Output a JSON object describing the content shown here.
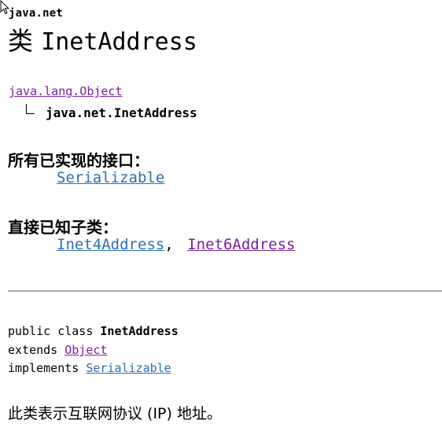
{
  "header": {
    "package_name": "java.net",
    "title_kind": "类",
    "class_name": "InetAddress"
  },
  "hierarchy": {
    "superclass": "java.lang.Object",
    "this_class": "java.net.InetAddress"
  },
  "interfaces": {
    "heading": "所有已实现的接口：",
    "items": [
      "Serializable"
    ]
  },
  "subclasses": {
    "heading": "直接已知子类：",
    "items": [
      "Inet4Address",
      "Inet6Address"
    ],
    "separator": ","
  },
  "declaration": {
    "modifiers": "public class",
    "name": "InetAddress",
    "extends_kw": "extends",
    "extends_link": "Object",
    "implements_kw": "implements",
    "implements_link": "Serializable"
  },
  "description": "此类表示互联网协议 (IP) 地址。",
  "colors": {
    "link_visited": "#7a1fa2",
    "link_unvisited": "#2a6fb8",
    "rule": "#a9a9a9"
  },
  "icons": {
    "cursor": "mouse-pointer-icon"
  }
}
